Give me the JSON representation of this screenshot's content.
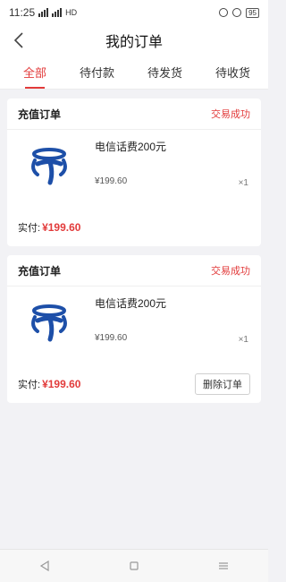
{
  "status_bar": {
    "time": "11:25",
    "network": "HD",
    "battery": "95"
  },
  "header": {
    "title": "我的订单"
  },
  "tabs": [
    {
      "label": "全部",
      "active": true
    },
    {
      "label": "待付款",
      "active": false
    },
    {
      "label": "待发货",
      "active": false
    },
    {
      "label": "待收货",
      "active": false
    }
  ],
  "orders": [
    {
      "type": "充值订单",
      "status": "交易成功",
      "product": "电信话费200元",
      "unit_price": "¥199.60",
      "quantity": "×1",
      "paid_label": "实付:",
      "paid_amount": "¥199.60"
    },
    {
      "type": "充值订单",
      "status": "交易成功",
      "product": "电信话费200元",
      "unit_price": "¥199.60",
      "quantity": "×1",
      "paid_label": "实付:",
      "paid_amount": "¥199.60",
      "action": "删除订单"
    }
  ],
  "colors": {
    "accent": "#e23b3b",
    "logo": "#1d4fa8",
    "background": "#f2f2f5"
  },
  "icons": {
    "back": "chevron-left-icon",
    "logo": "china-telecom-logo-icon",
    "nav": [
      "back-triangle-icon",
      "home-square-icon",
      "menu-lines-icon"
    ]
  }
}
